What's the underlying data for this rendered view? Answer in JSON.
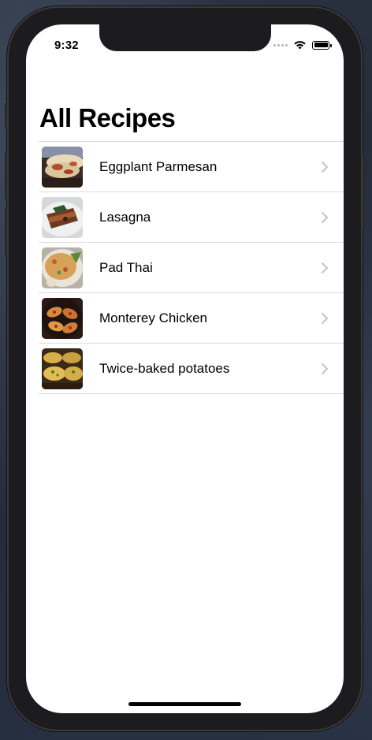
{
  "status_bar": {
    "time": "9:32",
    "signal_icon": "cellular-dots-icon",
    "wifi_icon": "wifi-icon",
    "battery_icon": "battery-icon"
  },
  "header": {
    "title": "All Recipes"
  },
  "recipes": [
    {
      "name": "Eggplant Parmesan",
      "thumbnail": "eggplant-parmesan-photo",
      "accessory": "chevron-right-icon"
    },
    {
      "name": "Lasagna",
      "thumbnail": "lasagna-photo",
      "accessory": "chevron-right-icon"
    },
    {
      "name": "Pad Thai",
      "thumbnail": "pad-thai-photo",
      "accessory": "chevron-right-icon"
    },
    {
      "name": "Monterey Chicken",
      "thumbnail": "monterey-chicken-photo",
      "accessory": "chevron-right-icon"
    },
    {
      "name": "Twice-baked potatoes",
      "thumbnail": "twice-baked-potatoes-photo",
      "accessory": "chevron-right-icon"
    }
  ],
  "colors": {
    "separator": "#dcdcdf",
    "chevron": "#c4c4c7",
    "text": "#000000",
    "background": "#ffffff"
  }
}
